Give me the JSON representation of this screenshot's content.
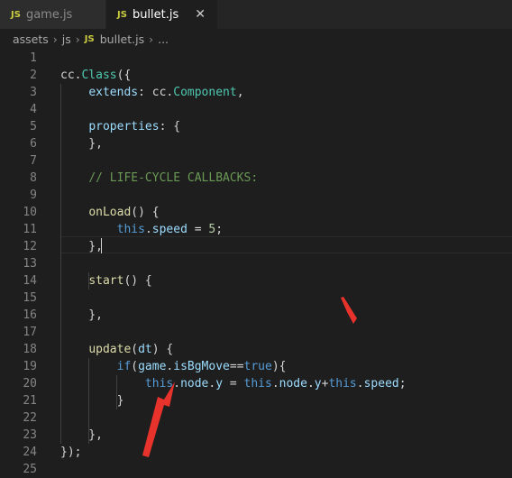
{
  "tabs": [
    {
      "badge": "JS",
      "label": "game.js",
      "active": false
    },
    {
      "badge": "JS",
      "label": "bullet.js",
      "active": true,
      "close": "✕"
    }
  ],
  "breadcrumb": {
    "items": [
      "assets",
      "js",
      "bullet.js",
      "..."
    ],
    "badge": "JS"
  },
  "code": {
    "line_numbers": [
      "1",
      "2",
      "3",
      "4",
      "5",
      "6",
      "7",
      "8",
      "9",
      "10",
      "11",
      "12",
      "13",
      "14",
      "15",
      "16",
      "17",
      "18",
      "19",
      "20",
      "21",
      "22",
      "23",
      "24",
      "25"
    ],
    "lines": [
      [],
      [
        [
          "plain",
          "cc."
        ],
        [
          "type",
          "Class"
        ],
        [
          "plain",
          "("
        ],
        [
          "plain",
          "{"
        ]
      ],
      [
        [
          "plain",
          "    "
        ],
        [
          "prop",
          "extends"
        ],
        [
          "plain",
          ": cc."
        ],
        [
          "type",
          "Component"
        ],
        [
          "plain",
          ","
        ]
      ],
      [],
      [
        [
          "plain",
          "    "
        ],
        [
          "prop",
          "properties"
        ],
        [
          "plain",
          ": {"
        ]
      ],
      [
        [
          "plain",
          "    },"
        ]
      ],
      [],
      [
        [
          "plain",
          "    "
        ],
        [
          "cmt",
          "// LIFE-CYCLE CALLBACKS:"
        ]
      ],
      [],
      [
        [
          "plain",
          "    "
        ],
        [
          "fn",
          "onLoad"
        ],
        [
          "plain",
          "() {"
        ]
      ],
      [
        [
          "plain",
          "        "
        ],
        [
          "kw",
          "this"
        ],
        [
          "plain",
          "."
        ],
        [
          "prop",
          "speed"
        ],
        [
          "plain",
          " = "
        ],
        [
          "num",
          "5"
        ],
        [
          "plain",
          ";"
        ]
      ],
      [
        [
          "plain",
          "    },"
        ]
      ],
      [],
      [
        [
          "plain",
          "    "
        ],
        [
          "fn",
          "start"
        ],
        [
          "plain",
          "() {"
        ]
      ],
      [],
      [
        [
          "plain",
          "    },"
        ]
      ],
      [],
      [
        [
          "plain",
          "    "
        ],
        [
          "fn",
          "update"
        ],
        [
          "plain",
          "("
        ],
        [
          "prop",
          "dt"
        ],
        [
          "plain",
          ") {"
        ]
      ],
      [
        [
          "plain",
          "        "
        ],
        [
          "kw",
          "if"
        ],
        [
          "plain",
          "("
        ],
        [
          "prop",
          "game"
        ],
        [
          "plain",
          "."
        ],
        [
          "prop",
          "isBgMove"
        ],
        [
          "plain",
          "=="
        ],
        [
          "kw",
          "true"
        ],
        [
          "plain",
          "){"
        ]
      ],
      [
        [
          "plain",
          "            "
        ],
        [
          "kw",
          "this"
        ],
        [
          "plain",
          "."
        ],
        [
          "prop",
          "node"
        ],
        [
          "plain",
          "."
        ],
        [
          "prop",
          "y"
        ],
        [
          "plain",
          " = "
        ],
        [
          "kw",
          "this"
        ],
        [
          "plain",
          "."
        ],
        [
          "prop",
          "node"
        ],
        [
          "plain",
          "."
        ],
        [
          "prop",
          "y"
        ],
        [
          "plain",
          "+"
        ],
        [
          "kw",
          "this"
        ],
        [
          "plain",
          "."
        ],
        [
          "prop",
          "speed"
        ],
        [
          "plain",
          ";"
        ]
      ],
      [
        [
          "plain",
          "        }"
        ]
      ],
      [],
      [
        [
          "plain",
          "    },"
        ]
      ],
      [
        [
          "plain",
          "}"
        ],
        [
          "plain",
          ");"
        ]
      ],
      []
    ]
  },
  "annotations": {
    "arrow_color": "#e8322c"
  }
}
